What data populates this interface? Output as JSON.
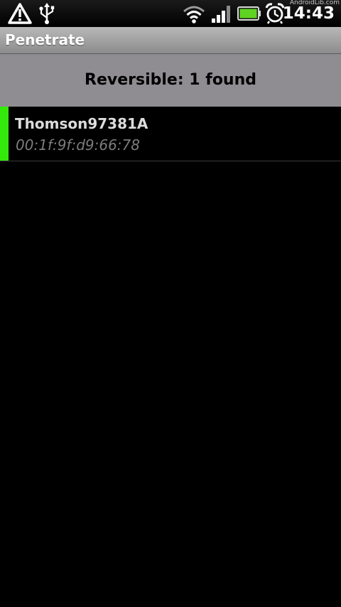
{
  "status_bar": {
    "time": "14:43",
    "watermark": "AndroidLib.com",
    "icons": [
      "warning-icon",
      "usb-icon",
      "wifi-icon",
      "signal-icon",
      "battery-icon",
      "alarm-icon"
    ],
    "battery_color": "#5fd321"
  },
  "app": {
    "title": "Penetrate"
  },
  "header": {
    "text": "Reversible: 1 found"
  },
  "networks": [
    {
      "name": "Thomson97381A",
      "mac": "00:1f:9f:d9:66:78",
      "status_color": "#33e80a"
    }
  ]
}
